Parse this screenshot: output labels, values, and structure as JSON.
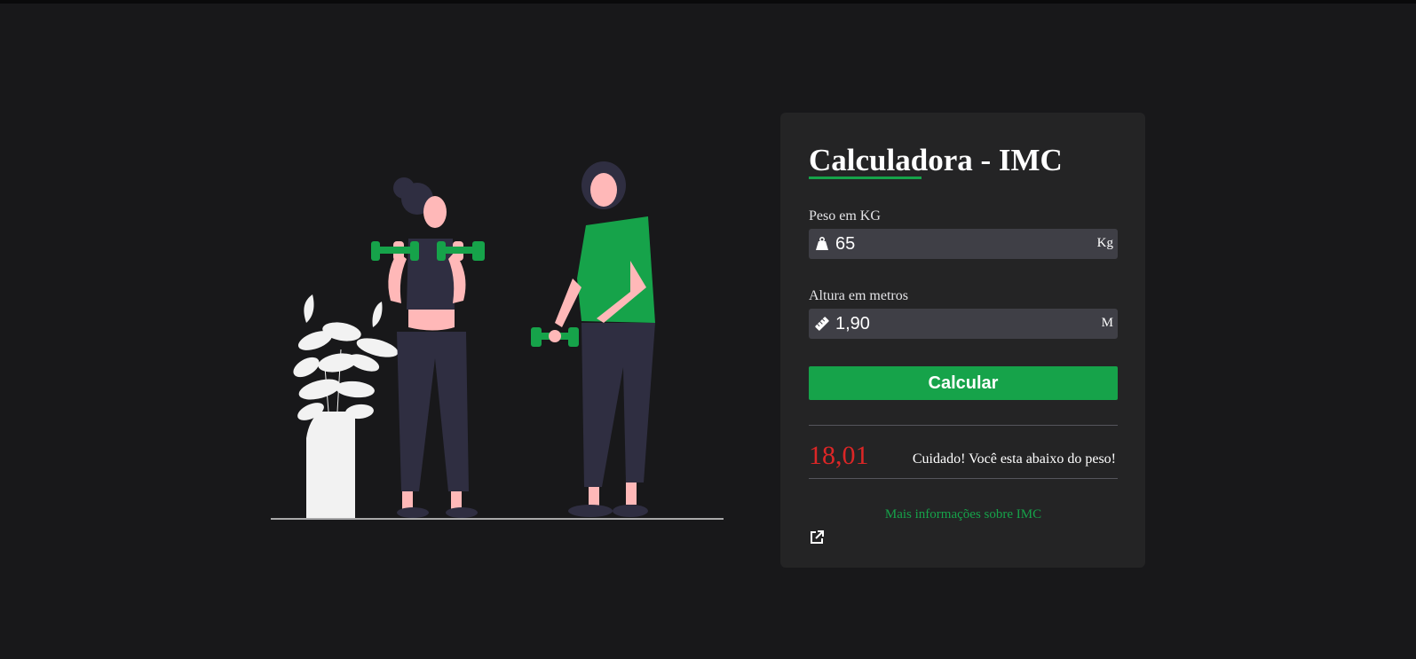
{
  "card": {
    "title": "Calculadora - IMC",
    "weight": {
      "label": "Peso em KG",
      "value": "65",
      "unit": "Kg",
      "icon": "weight-icon"
    },
    "height": {
      "label": "Altura em metros",
      "value": "1,90",
      "unit": "M",
      "icon": "ruler-icon"
    },
    "button_label": "Calcular",
    "result": {
      "value": "18,01",
      "message": "Cuidado! Você esta abaixo do peso!"
    },
    "more_info_link": "Mais informações sobre IMC",
    "external_icon": "external-link-icon"
  },
  "illustration": {
    "subject": "people-exercising-with-dumbbells"
  },
  "colors": {
    "background": "#18181a",
    "card": "#242425",
    "accent": "#16a34a",
    "input": "#3f3f46",
    "result": "#dc2626"
  }
}
